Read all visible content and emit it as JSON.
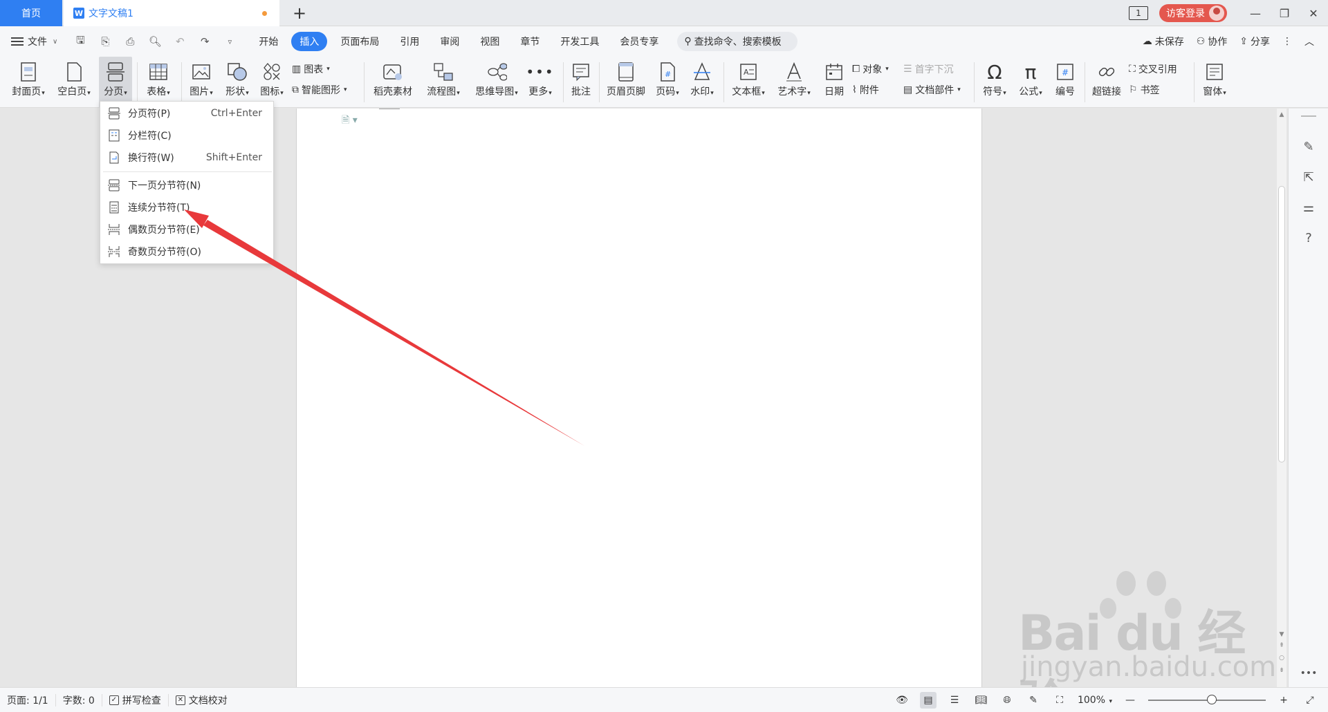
{
  "titlebar": {
    "home_tab": "首页",
    "doc_tab": "文字文稿1",
    "new_tab_symbol": "+",
    "one_icon_text": "1",
    "guest_login": "访客登录"
  },
  "menubar": {
    "file": "文件",
    "items": [
      "开始",
      "插入",
      "页面布局",
      "引用",
      "审阅",
      "视图",
      "章节",
      "开发工具",
      "会员专享"
    ],
    "active": "插入",
    "search_placeholder": "查找命令、搜索模板",
    "unsaved": "未保存",
    "collaborate": "协作",
    "share": "分享"
  },
  "ribbon": {
    "cover": "封面页",
    "blank": "空白页",
    "page_break": "分页",
    "table": "表格",
    "picture": "图片",
    "shape": "形状",
    "icon": "图标",
    "chart": "图表",
    "smart_art": "智能图形",
    "daoke": "稻壳素材",
    "flowchart": "流程图",
    "mindmap": "思维导图",
    "more": "更多",
    "comment": "批注",
    "header_footer": "页眉页脚",
    "page_number": "页码",
    "watermark": "水印",
    "textbox": "文本框",
    "wordart": "艺术字",
    "date": "日期",
    "object": "对象",
    "drop_cap": "首字下沉",
    "attachment": "附件",
    "doc_parts": "文档部件",
    "symbol": "符号",
    "formula": "公式",
    "numbering": "编号",
    "hyperlink": "超链接",
    "cross_ref": "交叉引用",
    "bookmark": "书签",
    "window": "窗体"
  },
  "dropdown": {
    "items": [
      {
        "label": "分页符(P)",
        "shortcut": "Ctrl+Enter"
      },
      {
        "label": "分栏符(C)",
        "shortcut": ""
      },
      {
        "label": "换行符(W)",
        "shortcut": "Shift+Enter"
      },
      {
        "label": "下一页分节符(N)",
        "shortcut": ""
      },
      {
        "label": "连续分节符(T)",
        "shortcut": ""
      },
      {
        "label": "偶数页分节符(E)",
        "shortcut": ""
      },
      {
        "label": "奇数页分节符(O)",
        "shortcut": ""
      }
    ]
  },
  "statusbar": {
    "page": "页面: 1/1",
    "words": "字数: 0",
    "spell_check": "拼写检查",
    "doc_proof": "文档校对",
    "zoom": "100%"
  },
  "watermark": {
    "brand": "Bai du 经验",
    "url": "jingyan.baidu.com"
  },
  "colors": {
    "accent": "#2f7ff2",
    "guest_button": "#e4574e",
    "arrow": "#e8393b"
  }
}
